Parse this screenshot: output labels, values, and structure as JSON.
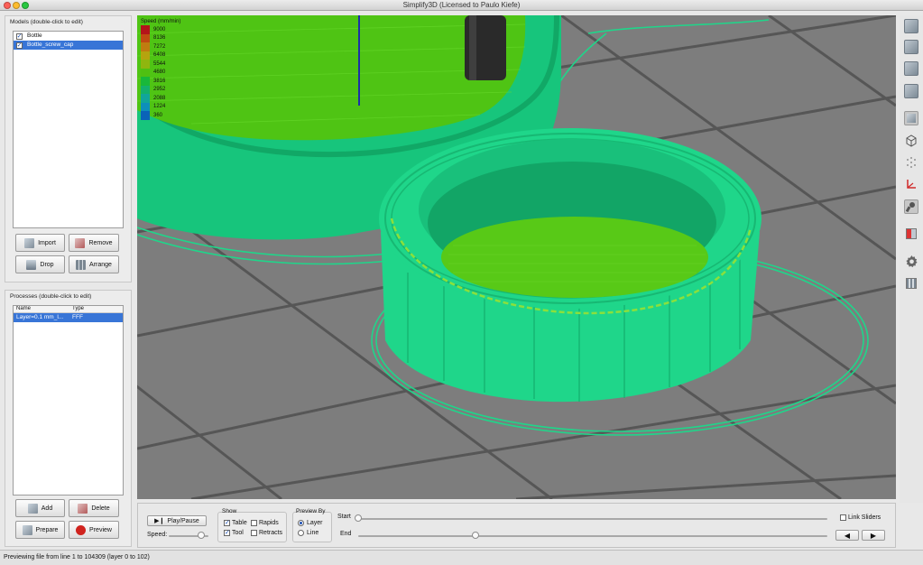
{
  "window": {
    "title": "Simplify3D (Licensed to Paulo Kiefe)"
  },
  "models": {
    "label": "Models (double-click to edit)",
    "items": [
      {
        "name": "Bottle",
        "checked": true,
        "selected": false
      },
      {
        "name": "Bottle_screw_cap",
        "checked": true,
        "selected": true
      }
    ],
    "buttons": {
      "import": "Import",
      "remove": "Remove",
      "drop": "Drop",
      "arrange": "Arrange"
    }
  },
  "processes": {
    "label": "Processes (double-click to edit)",
    "columns": [
      "Name",
      "Type"
    ],
    "rows": [
      {
        "name": "Layer=0.1 mm_l...",
        "type": "FFF"
      }
    ],
    "buttons": {
      "add": "Add",
      "delete": "Delete",
      "prepare": "Prepare",
      "preview": "Preview"
    }
  },
  "legend": {
    "title": "Speed (mm/min)",
    "entries": [
      {
        "value": "9000",
        "color": "#b3141a"
      },
      {
        "value": "8136",
        "color": "#c04a12"
      },
      {
        "value": "7272",
        "color": "#bf7c10"
      },
      {
        "value": "6408",
        "color": "#b5a40e"
      },
      {
        "value": "5544",
        "color": "#8fb60f"
      },
      {
        "value": "4680",
        "color": "#4fc012"
      },
      {
        "value": "3816",
        "color": "#19b83a"
      },
      {
        "value": "2952",
        "color": "#14b06c"
      },
      {
        "value": "2088",
        "color": "#11a59a"
      },
      {
        "value": "1224",
        "color": "#0d8fba"
      },
      {
        "value": "360",
        "color": "#0a63b8"
      }
    ]
  },
  "controls": {
    "play_pause": "Play/Pause",
    "speed_label": "Speed:",
    "speed_level": 0.82,
    "show": {
      "label": "Show",
      "table": {
        "label": "Table",
        "checked": true
      },
      "rapids": {
        "label": "Rapids",
        "checked": false
      },
      "tool": {
        "label": "Tool",
        "checked": true
      },
      "retracts": {
        "label": "Retracts",
        "checked": false
      }
    },
    "preview_by": {
      "label": "Preview By",
      "layer": {
        "label": "Layer",
        "selected": true
      },
      "line": {
        "label": "Line",
        "selected": false
      }
    },
    "start_label": "Start",
    "end_label": "End",
    "start_level": 0.0,
    "end_level": 0.25,
    "link_sliders": {
      "label": "Link Sliders",
      "checked": false
    },
    "prev_icon": "left-triangle-icon",
    "next_icon": "right-triangle-icon"
  },
  "status": {
    "text": "Previewing file from line 1 to 104309 (layer 0 to 102)"
  },
  "colors": {
    "viewport_bg": "#7d7d7d",
    "print_green": "#1fd68a",
    "infill_green": "#58c917",
    "selection_blue": "#3875d7"
  },
  "toolbar_icons": [
    "view-front-icon",
    "view-back-icon",
    "view-left-icon",
    "view-right-icon",
    "view-solid-icon",
    "view-wireframe-icon",
    "view-points-icon",
    "axes-icon",
    "tool-icon",
    "cross-section-icon",
    "settings-gear-icon",
    "bed-icon"
  ]
}
